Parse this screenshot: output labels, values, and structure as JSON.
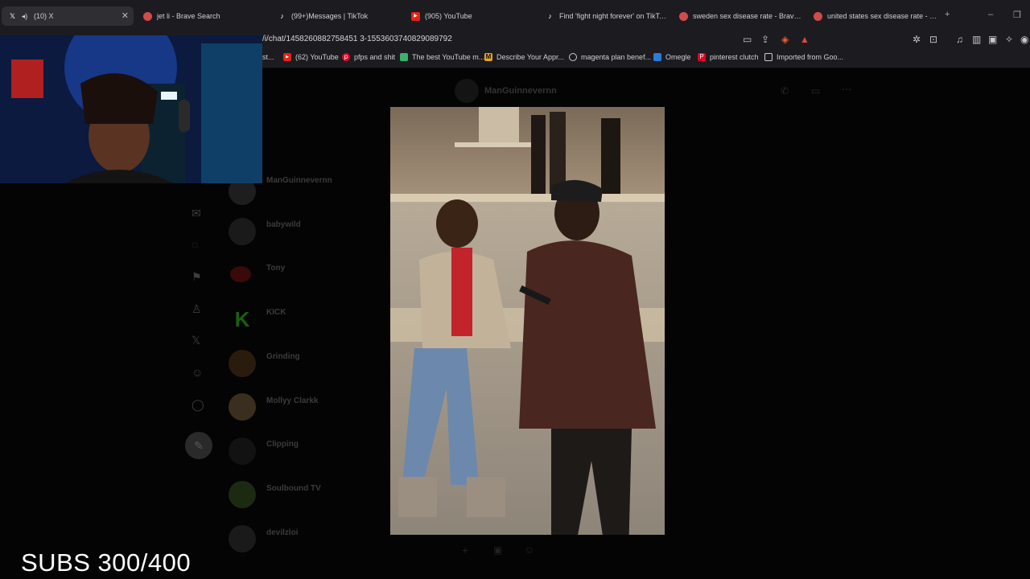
{
  "tabs": [
    {
      "title": "(10) X",
      "icon": "x-logo-icon"
    },
    {
      "title": "jet li - Brave Search",
      "icon": "brave-search-icon"
    },
    {
      "title": "(99+)Messages | TikTok",
      "icon": "tiktok-icon"
    },
    {
      "title": "(905) YouTube",
      "icon": "youtube-icon"
    },
    {
      "title": "Find 'fight night forever' on TikTok |",
      "icon": "tiktok-icon"
    },
    {
      "title": "sweden sex disease rate - Brave Search",
      "icon": "brave-search-icon"
    },
    {
      "title": "united states sex disease rate - Brave",
      "icon": "brave-search-icon"
    }
  ],
  "address_bar": {
    "url": "/i/chat/1458260882758451 3-1553603740829089792"
  },
  "bookmarks": [
    {
      "label": "st...",
      "icon": "bookmark-icon"
    },
    {
      "label": "(62) YouTube",
      "icon": "youtube-icon"
    },
    {
      "label": "pfps and shit",
      "icon": "pinterest-icon"
    },
    {
      "label": "The best YouTube m...",
      "icon": "bookmark-icon"
    },
    {
      "label": "Describe Your Appr...",
      "icon": "bookmark-icon"
    },
    {
      "label": "magenta plan benef...",
      "icon": "search-icon"
    },
    {
      "label": "Omegle",
      "icon": "omegle-icon"
    },
    {
      "label": "pinterest clutch",
      "icon": "pinterest-icon"
    },
    {
      "label": "Imported from Goo...",
      "icon": "folder-icon"
    }
  ],
  "conversations": [
    {
      "name": "ManGuinnevernn"
    },
    {
      "name": "babywild"
    },
    {
      "name": "Tony"
    },
    {
      "name": "KICK"
    },
    {
      "name": "Grinding"
    },
    {
      "name": "Mollyy Clarkk"
    },
    {
      "name": "Clipping"
    },
    {
      "name": "Soulbound TV"
    },
    {
      "name": "devilzloi"
    }
  ],
  "chat_header": {
    "name": "ManGuinnevernn"
  },
  "overlay": {
    "subs_text": "SUBS 300/400"
  },
  "colors": {
    "chrome": "#1c1c20",
    "page": "#040404",
    "accent_kick": "#53fc18"
  }
}
